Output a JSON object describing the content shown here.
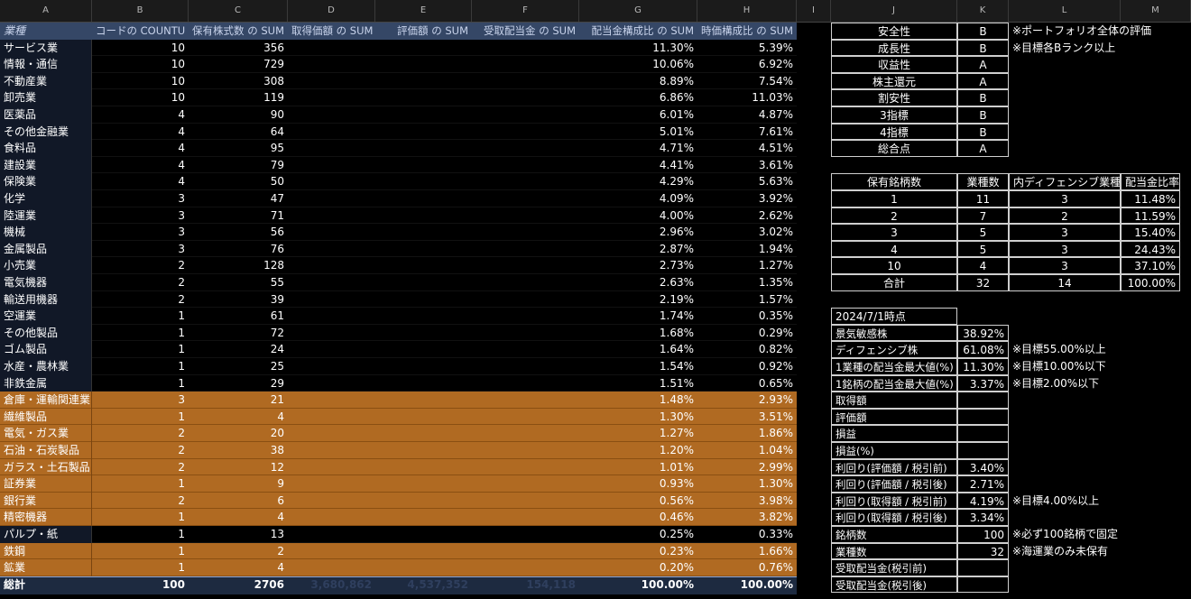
{
  "columns": [
    "A",
    "B",
    "C",
    "D",
    "E",
    "F",
    "G",
    "H",
    "I",
    "J",
    "K",
    "L",
    "M"
  ],
  "pivot": {
    "headers": [
      "業種",
      "コードの COUNTU",
      "保有株式数 の SUM",
      "取得価額 の SUM",
      "評価額 の SUM",
      "受取配当金 の SUM",
      "配当金構成比 の SUM",
      "時価構成比 の SUM"
    ],
    "rows": [
      {
        "name": "サービス業",
        "count": "10",
        "shares": "356",
        "div": "11.30%",
        "mkt": "5.39%",
        "hl": false
      },
      {
        "name": "情報・通信",
        "count": "10",
        "shares": "729",
        "div": "10.06%",
        "mkt": "6.92%",
        "hl": false
      },
      {
        "name": "不動産業",
        "count": "10",
        "shares": "308",
        "div": "8.89%",
        "mkt": "7.54%",
        "hl": false
      },
      {
        "name": "卸売業",
        "count": "10",
        "shares": "119",
        "div": "6.86%",
        "mkt": "11.03%",
        "hl": false
      },
      {
        "name": "医薬品",
        "count": "4",
        "shares": "90",
        "div": "6.01%",
        "mkt": "4.87%",
        "hl": false
      },
      {
        "name": "その他金融業",
        "count": "4",
        "shares": "64",
        "div": "5.01%",
        "mkt": "7.61%",
        "hl": false
      },
      {
        "name": "食料品",
        "count": "4",
        "shares": "95",
        "div": "4.71%",
        "mkt": "4.51%",
        "hl": false
      },
      {
        "name": "建設業",
        "count": "4",
        "shares": "79",
        "div": "4.41%",
        "mkt": "3.61%",
        "hl": false
      },
      {
        "name": "保険業",
        "count": "4",
        "shares": "50",
        "div": "4.29%",
        "mkt": "5.63%",
        "hl": false
      },
      {
        "name": "化学",
        "count": "3",
        "shares": "47",
        "div": "4.09%",
        "mkt": "3.92%",
        "hl": false
      },
      {
        "name": "陸運業",
        "count": "3",
        "shares": "71",
        "div": "4.00%",
        "mkt": "2.62%",
        "hl": false
      },
      {
        "name": "機械",
        "count": "3",
        "shares": "56",
        "div": "2.96%",
        "mkt": "3.02%",
        "hl": false
      },
      {
        "name": "金属製品",
        "count": "3",
        "shares": "76",
        "div": "2.87%",
        "mkt": "1.94%",
        "hl": false
      },
      {
        "name": "小売業",
        "count": "2",
        "shares": "128",
        "div": "2.73%",
        "mkt": "1.27%",
        "hl": false
      },
      {
        "name": "電気機器",
        "count": "2",
        "shares": "55",
        "div": "2.63%",
        "mkt": "1.35%",
        "hl": false
      },
      {
        "name": "輸送用機器",
        "count": "2",
        "shares": "39",
        "div": "2.19%",
        "mkt": "1.57%",
        "hl": false
      },
      {
        "name": "空運業",
        "count": "1",
        "shares": "61",
        "div": "1.74%",
        "mkt": "0.35%",
        "hl": false
      },
      {
        "name": "その他製品",
        "count": "1",
        "shares": "72",
        "div": "1.68%",
        "mkt": "0.29%",
        "hl": false
      },
      {
        "name": "ゴム製品",
        "count": "1",
        "shares": "24",
        "div": "1.64%",
        "mkt": "0.82%",
        "hl": false
      },
      {
        "name": "水産・農林業",
        "count": "1",
        "shares": "25",
        "div": "1.54%",
        "mkt": "0.92%",
        "hl": false
      },
      {
        "name": "非鉄金属",
        "count": "1",
        "shares": "29",
        "div": "1.51%",
        "mkt": "0.65%",
        "hl": false
      },
      {
        "name": "倉庫・運輸関連業",
        "count": "3",
        "shares": "21",
        "div": "1.48%",
        "mkt": "2.93%",
        "hl": true
      },
      {
        "name": "繊維製品",
        "count": "1",
        "shares": "4",
        "div": "1.30%",
        "mkt": "3.51%",
        "hl": true
      },
      {
        "name": "電気・ガス業",
        "count": "2",
        "shares": "20",
        "div": "1.27%",
        "mkt": "1.86%",
        "hl": true
      },
      {
        "name": "石油・石炭製品",
        "count": "2",
        "shares": "38",
        "div": "1.20%",
        "mkt": "1.04%",
        "hl": true
      },
      {
        "name": "ガラス・土石製品",
        "count": "2",
        "shares": "12",
        "div": "1.01%",
        "mkt": "2.99%",
        "hl": true
      },
      {
        "name": "証券業",
        "count": "1",
        "shares": "9",
        "div": "0.93%",
        "mkt": "1.30%",
        "hl": true
      },
      {
        "name": "銀行業",
        "count": "2",
        "shares": "6",
        "div": "0.56%",
        "mkt": "3.98%",
        "hl": true
      },
      {
        "name": "精密機器",
        "count": "1",
        "shares": "4",
        "div": "0.46%",
        "mkt": "3.82%",
        "hl": true
      },
      {
        "name": "パルプ・紙",
        "count": "1",
        "shares": "13",
        "div": "0.25%",
        "mkt": "0.33%",
        "hl": false
      },
      {
        "name": "鉄鋼",
        "count": "1",
        "shares": "2",
        "div": "0.23%",
        "mkt": "1.66%",
        "hl": true
      },
      {
        "name": "鉱業",
        "count": "1",
        "shares": "4",
        "div": "0.20%",
        "mkt": "0.76%",
        "hl": true
      }
    ],
    "total": {
      "name": "総計",
      "count": "100",
      "shares": "2706",
      "cost": "3,680,862",
      "value": "4,537,352",
      "dividend": "154,118",
      "div": "100.00%",
      "mkt": "100.00%"
    }
  },
  "ratings": {
    "rows": [
      {
        "label": "安全性",
        "grade": "B",
        "note": "※ポートフォリオ全体の評価"
      },
      {
        "label": "成長性",
        "grade": "B",
        "note": "※目標各Bランク以上"
      },
      {
        "label": "収益性",
        "grade": "A",
        "note": ""
      },
      {
        "label": "株主還元",
        "grade": "A",
        "note": ""
      },
      {
        "label": "割安性",
        "grade": "B",
        "note": ""
      },
      {
        "label": "3指標",
        "grade": "B",
        "note": ""
      },
      {
        "label": "4指標",
        "grade": "B",
        "note": ""
      },
      {
        "label": "総合点",
        "grade": "A",
        "note": ""
      }
    ]
  },
  "holdings": {
    "headers": [
      "保有銘柄数",
      "業種数",
      "内ディフェンシブ業種",
      "配当金比率"
    ],
    "rows": [
      [
        "1",
        "11",
        "3",
        "11.48%"
      ],
      [
        "2",
        "7",
        "2",
        "11.59%"
      ],
      [
        "3",
        "5",
        "3",
        "15.40%"
      ],
      [
        "4",
        "5",
        "3",
        "24.43%"
      ],
      [
        "10",
        "4",
        "3",
        "37.10%"
      ],
      [
        "合計",
        "32",
        "14",
        "100.00%"
      ]
    ]
  },
  "summary": {
    "title": "2024/7/1時点",
    "rows": [
      {
        "label": "景気敏感株",
        "value": "38.92%",
        "note": ""
      },
      {
        "label": "ディフェンシブ株",
        "value": "61.08%",
        "note": "※目標55.00%以上"
      },
      {
        "label": "1業種の配当金最大値(%)",
        "value": "11.30%",
        "note": "※目標10.00%以下"
      },
      {
        "label": "1銘柄の配当金最大値(%)",
        "value": "3.37%",
        "note": "※目標2.00%以下"
      },
      {
        "label": "取得額",
        "value": "",
        "note": ""
      },
      {
        "label": "評価額",
        "value": "",
        "note": ""
      },
      {
        "label": "損益",
        "value": "",
        "note": ""
      },
      {
        "label": "損益(%)",
        "value": "",
        "note": ""
      },
      {
        "label": "利回り(評価額 / 税引前)",
        "value": "3.40%",
        "note": ""
      },
      {
        "label": "利回り(評価額 / 税引後)",
        "value": "2.71%",
        "note": ""
      },
      {
        "label": "利回り(取得額 / 税引前)",
        "value": "4.19%",
        "note": "※目標4.00%以上"
      },
      {
        "label": "利回り(取得額 / 税引後)",
        "value": "3.34%",
        "note": ""
      },
      {
        "label": "銘柄数",
        "value": "100",
        "note": "※必ず100銘柄で固定"
      },
      {
        "label": "業種数",
        "value": "32",
        "note": "※海運業のみ未保有"
      },
      {
        "label": "受取配当金(税引前)",
        "value": "",
        "note": ""
      },
      {
        "label": "受取配当金(税引後)",
        "value": "",
        "note": ""
      }
    ]
  }
}
